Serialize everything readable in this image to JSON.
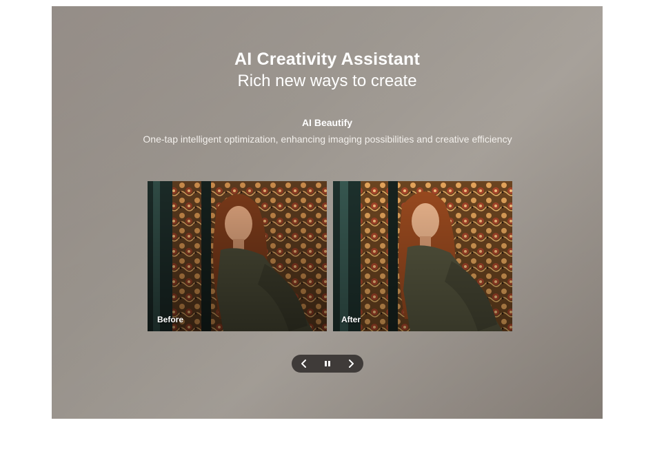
{
  "hero": {
    "title": "AI Creativity Assistant",
    "subtitle": "Rich new ways to create"
  },
  "feature": {
    "title": "AI Beautify",
    "description": "One-tap intelligent optimization, enhancing imaging possibilities and creative efficiency"
  },
  "comparison": {
    "before_label": "Before",
    "after_label": "After"
  },
  "controls": {
    "prev_icon": "chevron-left-icon",
    "pause_icon": "pause-icon",
    "next_icon": "chevron-right-icon"
  },
  "colors": {
    "panel_background": "#9a948d",
    "control_pill": "#3f3b39",
    "text": "#ffffff"
  }
}
